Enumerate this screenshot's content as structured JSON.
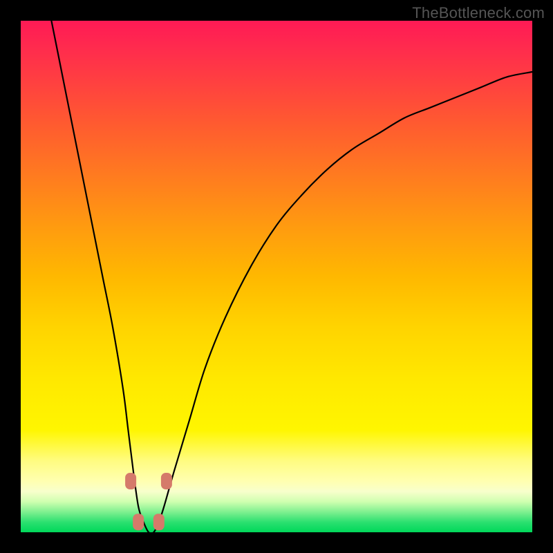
{
  "watermark": "TheBottleneck.com",
  "colors": {
    "background": "#000000",
    "curve_stroke": "#000000",
    "markers": "#d57a6a"
  },
  "chart_data": {
    "type": "line",
    "title": "",
    "xlabel": "",
    "ylabel": "",
    "xlim": [
      0,
      100
    ],
    "ylim": [
      0,
      100
    ],
    "grid": false,
    "legend": false,
    "series": [
      {
        "name": "bottleneck-curve",
        "x": [
          6,
          8,
          10,
          12,
          14,
          16,
          18,
          20,
          21,
          22,
          23,
          24,
          25,
          26,
          27,
          28,
          30,
          33,
          36,
          40,
          45,
          50,
          55,
          60,
          65,
          70,
          75,
          80,
          85,
          90,
          95,
          100
        ],
        "y": [
          100,
          90,
          80,
          70,
          60,
          50,
          40,
          28,
          20,
          12,
          5,
          2,
          0,
          0,
          2,
          5,
          12,
          22,
          32,
          42,
          52,
          60,
          66,
          71,
          75,
          78,
          81,
          83,
          85,
          87,
          89,
          90
        ]
      }
    ],
    "markers": [
      {
        "x": 21.5,
        "y": 10
      },
      {
        "x": 23.0,
        "y": 2
      },
      {
        "x": 27.0,
        "y": 2
      },
      {
        "x": 28.5,
        "y": 10
      }
    ]
  }
}
